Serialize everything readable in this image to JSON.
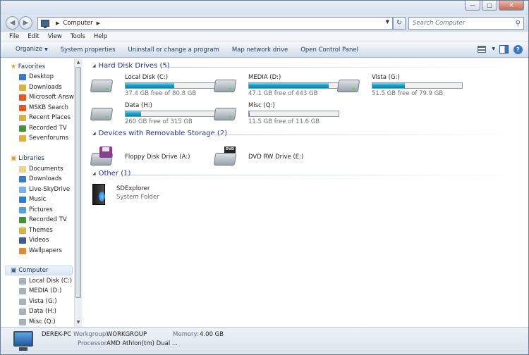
{
  "address": {
    "location": "Computer"
  },
  "search": {
    "placeholder": "Search Computer"
  },
  "menu": [
    "File",
    "Edit",
    "View",
    "Tools",
    "Help"
  ],
  "commands": [
    "Organize",
    "System properties",
    "Uninstall or change a program",
    "Map network drive",
    "Open Control Panel"
  ],
  "nav": {
    "favorites_label": "Favorites",
    "favorites": [
      "Desktop",
      "Downloads",
      "Microsoft Answe",
      "MSKB Search",
      "Recent Places",
      "Recorded TV",
      "Sevenforums"
    ],
    "libraries_label": "Libraries",
    "libraries": [
      "Documents",
      "Downloads",
      "Live-SkyDrive",
      "Music",
      "Pictures",
      "Recorded TV",
      "Themes",
      "Videos",
      "Wallpapers"
    ],
    "computer_label": "Computer",
    "computer": [
      "Local Disk (C:)",
      "MEDIA (D:)",
      "Vista (G:)",
      "Data (H:)",
      "Misc (Q:)"
    ]
  },
  "groups": {
    "hdd_title": "Hard Disk Drives (5)",
    "removable_title": "Devices with Removable Storage (2)",
    "other_title": "Other (1)"
  },
  "drives": [
    {
      "name": "Local Disk (C:)",
      "free": "37.4 GB free of 80.8 GB",
      "used_pct": 54
    },
    {
      "name": "MEDIA (D:)",
      "free": "47.1 GB free of 443 GB",
      "used_pct": 89
    },
    {
      "name": "Vista (G:)",
      "free": "51.5 GB free of 79.9 GB",
      "used_pct": 36
    },
    {
      "name": "Data (H:)",
      "free": "260 GB free of 315 GB",
      "used_pct": 17
    },
    {
      "name": "Misc (Q:)",
      "free": "11.5 GB free of 11.6 GB",
      "used_pct": 1
    }
  ],
  "removable": [
    {
      "name": "Floppy Disk Drive (A:)"
    },
    {
      "name": "DVD RW Drive (E:)",
      "badge": "DVD"
    }
  ],
  "other": [
    {
      "name": "SDExplorer",
      "type": "System Folder"
    }
  ],
  "details": {
    "pc_name": "DEREK-PC",
    "workgroup_label": "Workgroup:",
    "workgroup": "WORKGROUP",
    "memory_label": "Memory:",
    "memory": "4.00 GB",
    "processor_label": "Processor:",
    "processor": "AMD Athlon(tm) Dual ..."
  },
  "colors": {
    "accent": "#1e3287",
    "bar_fill": "#1b9ac8"
  }
}
